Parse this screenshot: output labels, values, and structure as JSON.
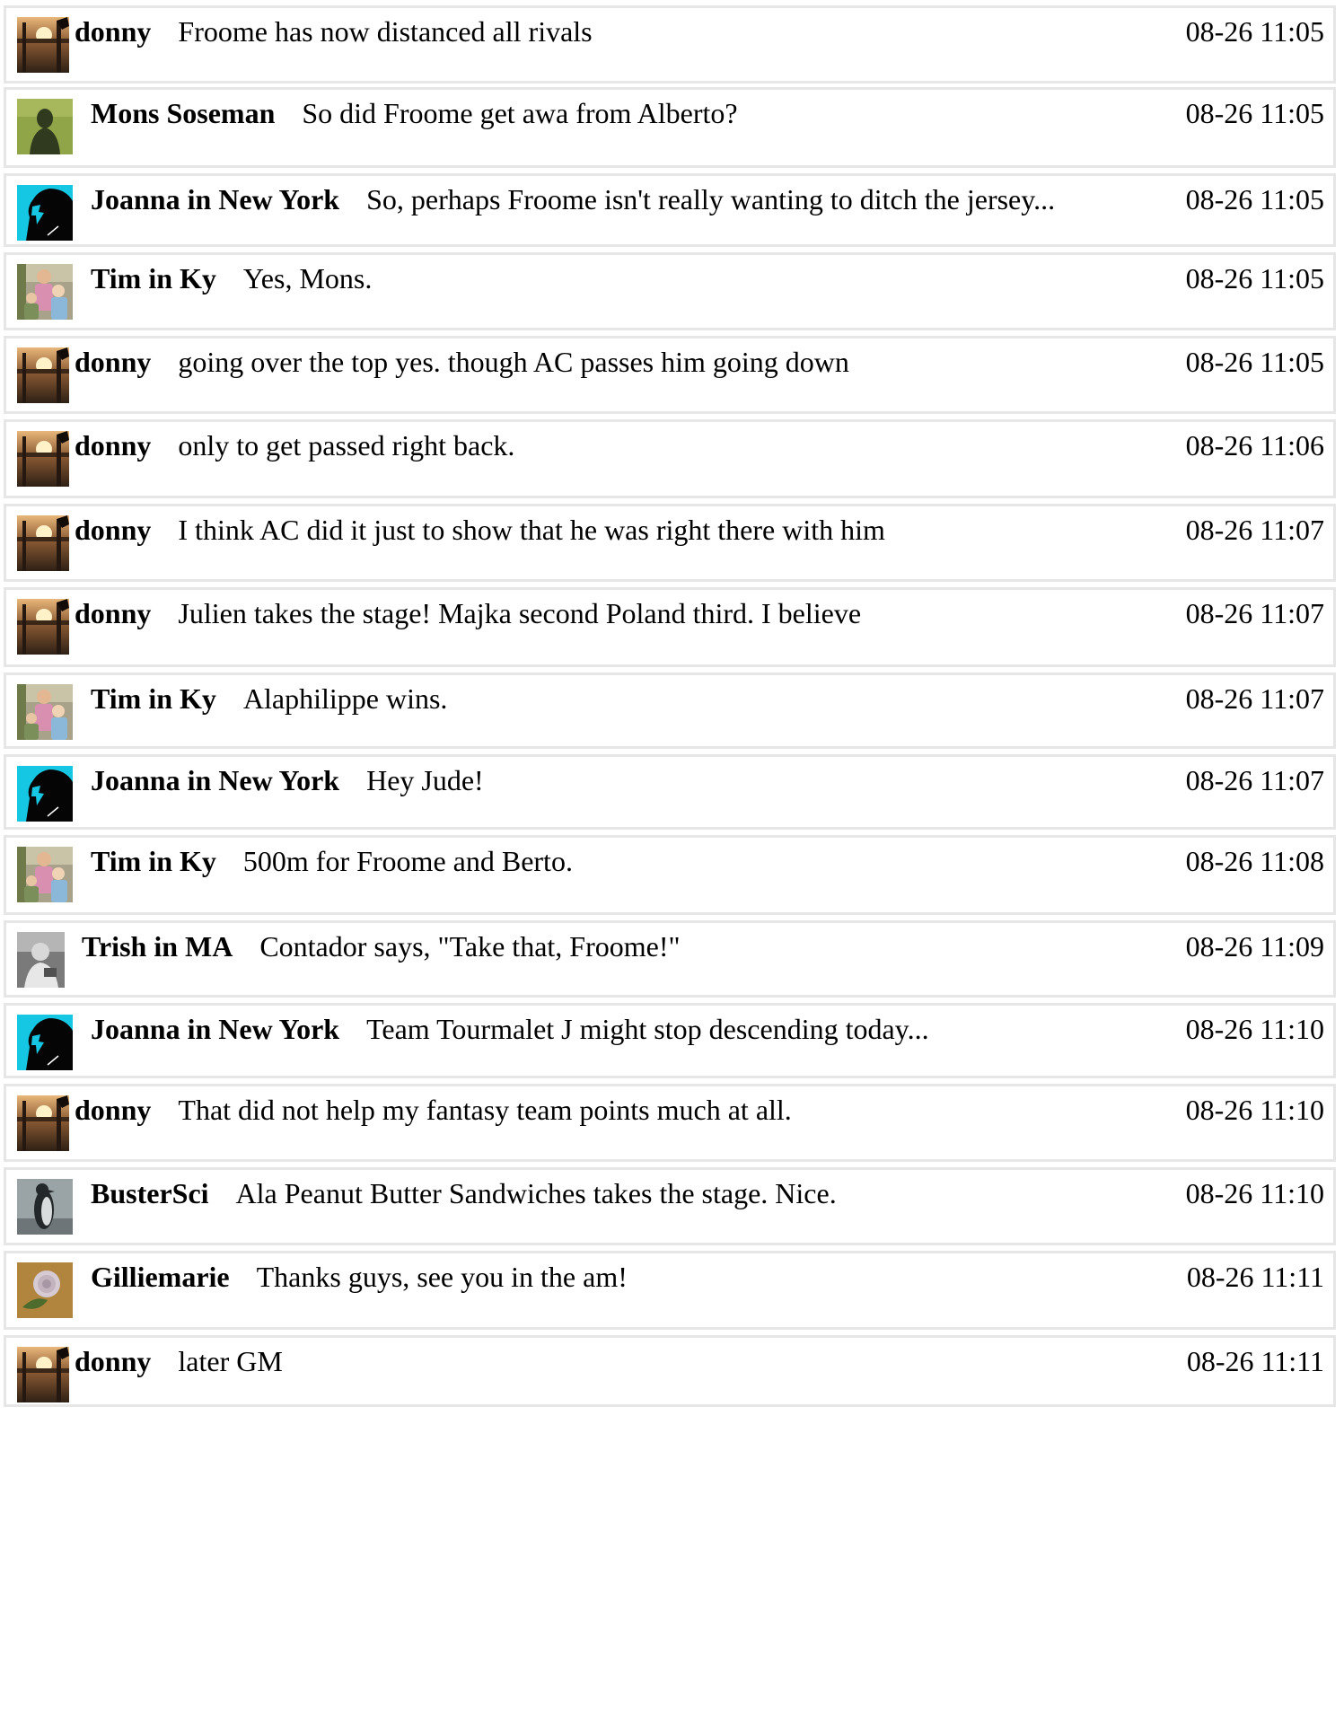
{
  "messages": [
    {
      "author": "donny",
      "text": "Froome has now distanced all rivals",
      "time": "08-26 11:05",
      "avatar": "donny-sunset-avatar"
    },
    {
      "author": "Mons Soseman",
      "text": "So did Froome get awa from Alberto?",
      "time": "08-26 11:05",
      "avatar": "shadow-grass-avatar"
    },
    {
      "author": "Joanna in New York",
      "text": "So, perhaps Froome isn't really wanting to ditch the jersey...",
      "time": "08-26 11:05",
      "avatar": "horse-head-avatar"
    },
    {
      "author": "Tim in Ky",
      "text": "Yes, Mons.",
      "time": "08-26 11:05",
      "avatar": "family-photo-avatar"
    },
    {
      "author": "donny",
      "text": "going over the top yes. though AC passes him going down",
      "time": "08-26 11:05",
      "avatar": "donny-sunset-avatar"
    },
    {
      "author": "donny",
      "text": "only to get passed right back.",
      "time": "08-26 11:06",
      "avatar": "donny-sunset-avatar"
    },
    {
      "author": "donny",
      "text": "I think AC did it just to show that he was right there with him",
      "time": "08-26 11:07",
      "avatar": "donny-sunset-avatar"
    },
    {
      "author": "donny",
      "text": "Julien takes the stage! Majka second Poland third. I believe",
      "time": "08-26 11:07",
      "avatar": "donny-sunset-avatar"
    },
    {
      "author": "Tim in Ky",
      "text": "Alaphilippe wins.",
      "time": "08-26 11:07",
      "avatar": "family-photo-avatar"
    },
    {
      "author": "Joanna in New York",
      "text": "Hey Jude!",
      "time": "08-26 11:07",
      "avatar": "horse-head-avatar"
    },
    {
      "author": "Tim in Ky",
      "text": "500m for Froome and Berto.",
      "time": "08-26 11:08",
      "avatar": "family-photo-avatar"
    },
    {
      "author": "Trish in MA",
      "text": "Contador says, \"Take that, Froome!\"",
      "time": "08-26 11:09",
      "avatar": "bw-photo-avatar"
    },
    {
      "author": "Joanna in New York",
      "text": "Team Tourmalet J might stop descending today...",
      "time": "08-26 11:10",
      "avatar": "horse-head-avatar"
    },
    {
      "author": "donny",
      "text": "That did not help my fantasy team points much at all.",
      "time": "08-26 11:10",
      "avatar": "donny-sunset-avatar"
    },
    {
      "author": "BusterSci",
      "text": "Ala Peanut Butter Sandwiches takes the stage. Nice.",
      "time": "08-26 11:10",
      "avatar": "penguin-avatar"
    },
    {
      "author": "Gilliemarie",
      "text": "Thanks guys, see you in the am!",
      "time": "08-26 11:11",
      "avatar": "rose-avatar"
    },
    {
      "author": "donny",
      "text": "later GM",
      "time": "08-26 11:11",
      "avatar": "donny-sunset-avatar"
    }
  ]
}
